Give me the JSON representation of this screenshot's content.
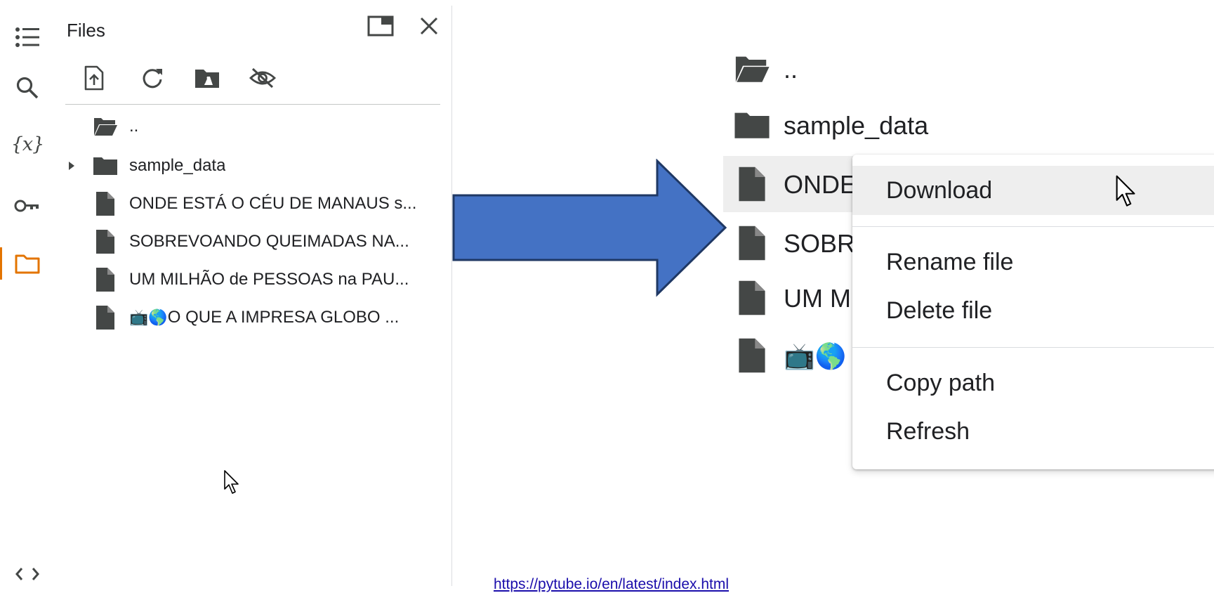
{
  "panel": {
    "title": "Files"
  },
  "rail": {
    "items": [
      {
        "name": "table-of-contents-icon"
      },
      {
        "name": "search-icon"
      },
      {
        "name": "variables-icon",
        "label": "{x}"
      },
      {
        "name": "key-icon"
      },
      {
        "name": "folder-icon",
        "active": true
      },
      {
        "name": "code-snippets-icon"
      }
    ]
  },
  "tree": {
    "items": [
      {
        "label": "..",
        "type": "parent"
      },
      {
        "label": "sample_data",
        "type": "folder"
      },
      {
        "label": "ONDE ESTÁ O CÉU DE MANAUS s...",
        "type": "file"
      },
      {
        "label": "SOBREVOANDO QUEIMADAS NA...",
        "type": "file"
      },
      {
        "label": "UM MILHÃO de PESSOAS na PAU...",
        "type": "file"
      },
      {
        "label": "O QUE A IMPRESA GLOBO ...",
        "type": "file",
        "emoji": "📺🌎"
      }
    ]
  },
  "zoom": {
    "items": [
      {
        "label": ".."
      },
      {
        "label": "sample_data"
      },
      {
        "label": "ONDE"
      },
      {
        "label": "SOBRI"
      },
      {
        "label": "UM M"
      },
      {
        "label": "",
        "emoji": "📺🌎"
      }
    ]
  },
  "context_menu": {
    "items": [
      {
        "label": "Download"
      },
      {
        "label": "Rename file"
      },
      {
        "label": "Delete file"
      },
      {
        "label": "Copy path"
      },
      {
        "label": "Refresh"
      }
    ]
  },
  "footer": {
    "link": "https://pytube.io/en/latest/index.html"
  },
  "colors": {
    "accent": "#e37400",
    "arrow_fill": "#4472c4",
    "arrow_stroke": "#1f3864",
    "icon": "#444746",
    "link": "#1a0dab"
  }
}
